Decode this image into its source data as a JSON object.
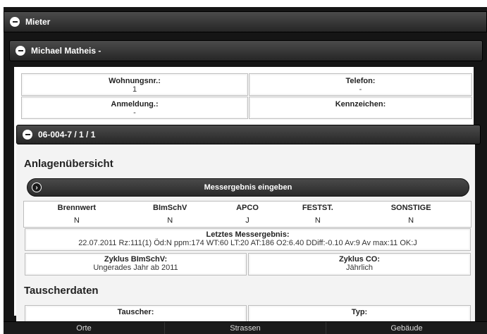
{
  "header": {
    "title": "Mieter"
  },
  "tenant": {
    "name": "Michael Matheis -",
    "wohnungsnr_label": "Wohnungsnr.:",
    "wohnungsnr_value": "1",
    "telefon_label": "Telefon:",
    "telefon_value": "-",
    "anmeldung_label": "Anmeldung.:",
    "anmeldung_value": "-",
    "kennzeichen_label": "Kennzeichen:",
    "kennzeichen_value": ""
  },
  "device": {
    "id": "06-004-7 / 1 / 1",
    "section_title": "Anlagenübersicht",
    "measure_button": "Messergebnis eingeben",
    "status_headers": [
      "Brennwert",
      "BImSchV",
      "APCO",
      "FESTST.",
      "SONSTIGE"
    ],
    "status_values": [
      "N",
      "N",
      "J",
      "N",
      "N"
    ],
    "last_result_label": "Letztes Messergebnis:",
    "last_result_value": "22.07.2011 Rz:111(1) Öd:N ppm:174 WT:60 LT:20 AT:186 O2:6.40 DDiff:-0.10 Av:9 Av max:11 OK:J",
    "zyklus_bimschv_label": "Zyklus BImSchV:",
    "zyklus_bimschv_value": "Ungerades Jahr ab 2011",
    "zyklus_co_label": "Zyklus CO:",
    "zyklus_co_value": "Jährlich"
  },
  "tauscher": {
    "section_title": "Tauscherdaten",
    "tauscher_label": "Tauscher:",
    "typ_label": "Typ:"
  },
  "tabs": [
    "Orte",
    "Strassen",
    "Gebäude"
  ]
}
